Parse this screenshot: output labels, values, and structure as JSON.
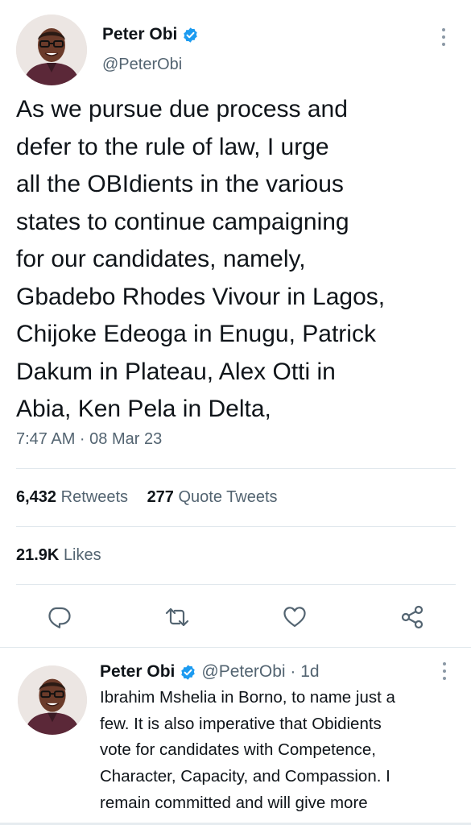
{
  "main_tweet": {
    "author_name": "Peter Obi",
    "handle": "@PeterObi",
    "text": "As we pursue due process and\ndefer to the rule of law, I urge\nall the OBIdients in the various\nstates to continue campaigning\nfor our candidates, namely,\nGbadebo Rhodes Vivour in Lagos,\nChijoke Edeoga in Enugu, Patrick\nDakum in Plateau, Alex Otti in\nAbia, Ken Pela in Delta,",
    "timestamp": "7:47 AM · 08 Mar 23",
    "retweets_count": "6,432",
    "retweets_label": "Retweets",
    "quotes_count": "277",
    "quotes_label": "Quote Tweets",
    "likes_count": "21.9K",
    "likes_label": "Likes"
  },
  "reply_tweet": {
    "author_name": "Peter Obi",
    "handle_time": "@PeterObi · 1d",
    "text": "Ibrahim Mshelia in Borno, to name just a\nfew. It is also imperative that Obidients\nvote for candidates with Competence,\nCharacter, Capacity, and Compassion. I\nremain committed and will give more"
  },
  "icons": {
    "verified": "verified-badge-icon",
    "more": "more-vertical-icon",
    "reply": "reply-icon",
    "retweet": "retweet-icon",
    "like": "heart-icon",
    "share": "share-icon"
  },
  "colors": {
    "verified": "#1d9bf0",
    "text_primary": "#0f1419",
    "text_secondary": "#536471",
    "divider": "#e1e8ed"
  }
}
